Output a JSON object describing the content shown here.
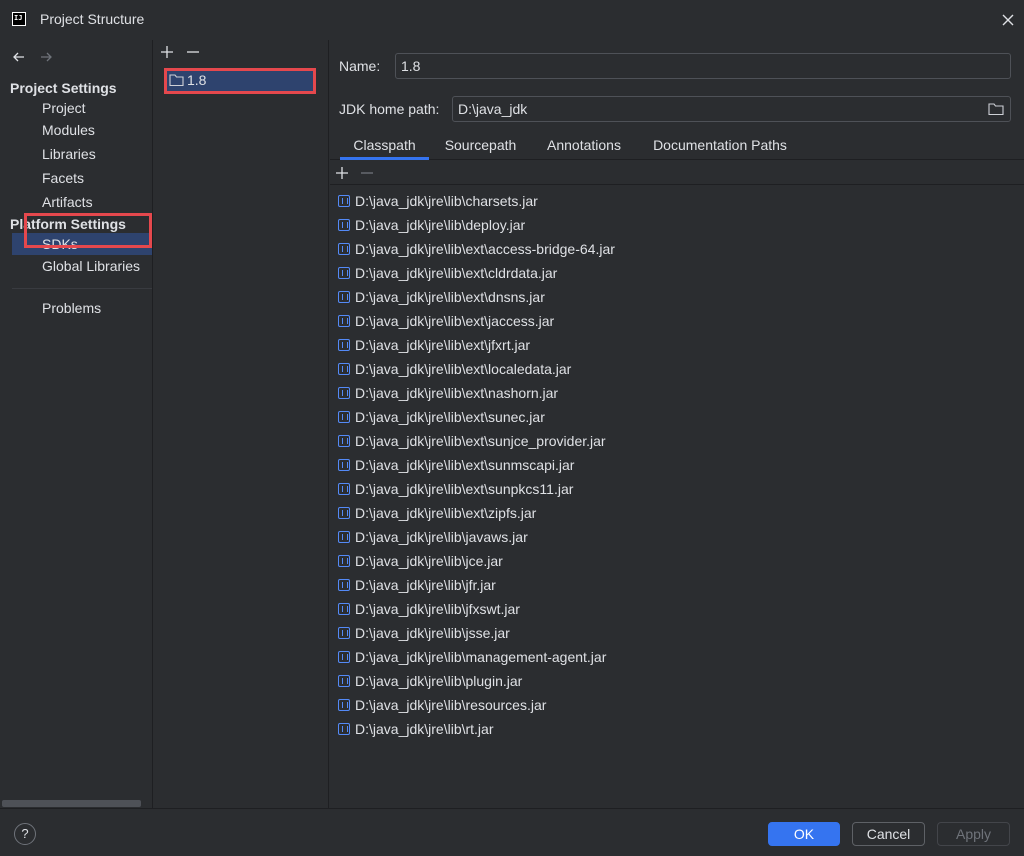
{
  "window": {
    "title": "Project Structure",
    "icon_text": "IJ"
  },
  "sidebar": {
    "project_settings_heading": "Project Settings",
    "project_items": [
      "Project",
      "Modules",
      "Libraries",
      "Facets",
      "Artifacts"
    ],
    "platform_settings_heading": "Platform Settings",
    "platform_items": [
      "SDKs",
      "Global Libraries"
    ],
    "problems": "Problems",
    "selected": "SDKs"
  },
  "sdk_list": {
    "items": [
      "1.8"
    ],
    "selected": "1.8"
  },
  "detail": {
    "name_label": "Name:",
    "name_value": "1.8",
    "home_label": "JDK home path:",
    "home_value": "D:\\java_jdk",
    "tabs": [
      "Classpath",
      "Sourcepath",
      "Annotations",
      "Documentation Paths"
    ],
    "active_tab": "Classpath",
    "classpath": [
      "D:\\java_jdk\\jre\\lib\\charsets.jar",
      "D:\\java_jdk\\jre\\lib\\deploy.jar",
      "D:\\java_jdk\\jre\\lib\\ext\\access-bridge-64.jar",
      "D:\\java_jdk\\jre\\lib\\ext\\cldrdata.jar",
      "D:\\java_jdk\\jre\\lib\\ext\\dnsns.jar",
      "D:\\java_jdk\\jre\\lib\\ext\\jaccess.jar",
      "D:\\java_jdk\\jre\\lib\\ext\\jfxrt.jar",
      "D:\\java_jdk\\jre\\lib\\ext\\localedata.jar",
      "D:\\java_jdk\\jre\\lib\\ext\\nashorn.jar",
      "D:\\java_jdk\\jre\\lib\\ext\\sunec.jar",
      "D:\\java_jdk\\jre\\lib\\ext\\sunjce_provider.jar",
      "D:\\java_jdk\\jre\\lib\\ext\\sunmscapi.jar",
      "D:\\java_jdk\\jre\\lib\\ext\\sunpkcs11.jar",
      "D:\\java_jdk\\jre\\lib\\ext\\zipfs.jar",
      "D:\\java_jdk\\jre\\lib\\javaws.jar",
      "D:\\java_jdk\\jre\\lib\\jce.jar",
      "D:\\java_jdk\\jre\\lib\\jfr.jar",
      "D:\\java_jdk\\jre\\lib\\jfxswt.jar",
      "D:\\java_jdk\\jre\\lib\\jsse.jar",
      "D:\\java_jdk\\jre\\lib\\management-agent.jar",
      "D:\\java_jdk\\jre\\lib\\plugin.jar",
      "D:\\java_jdk\\jre\\lib\\resources.jar",
      "D:\\java_jdk\\jre\\lib\\rt.jar"
    ]
  },
  "footer": {
    "help": "?",
    "ok": "OK",
    "cancel": "Cancel",
    "apply": "Apply"
  },
  "colors": {
    "accent": "#3574f0",
    "selection": "#2e436e",
    "highlight": "#e5484d",
    "background": "#2b2d30"
  }
}
